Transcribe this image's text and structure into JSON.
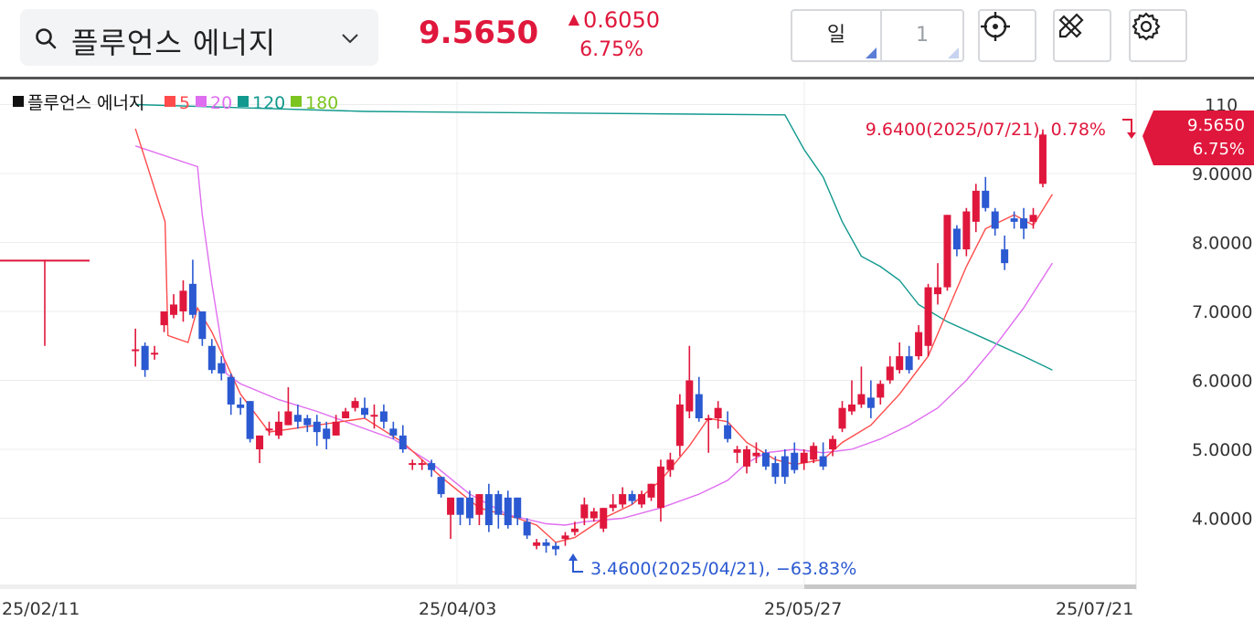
{
  "header": {
    "stock_name": "플루언스 에너지",
    "price": "9.5650",
    "change": "0.6050",
    "change_pct": "6.75%",
    "period_unit": "일",
    "period_count": "1"
  },
  "colors": {
    "up": "#e0173c",
    "down": "#2b59d1",
    "ma5": "#ff4b4b",
    "ma20": "#e06ef0",
    "ma120": "#11998e",
    "ma180": "#7cc520"
  },
  "icons": [
    "search-icon",
    "chevron-down-icon",
    "crosshair-icon",
    "drawing-tools-icon",
    "gear-icon"
  ],
  "chart_data": {
    "type": "candlestick",
    "legend": [
      {
        "label": "플루언스 에너지",
        "color": "#111111"
      },
      {
        "label": "5",
        "color": "#ff4b4b"
      },
      {
        "label": "20",
        "color": "#e06ef0"
      },
      {
        "label": "120",
        "color": "#11998e"
      },
      {
        "label": "180",
        "color": "#7cc520"
      }
    ],
    "x_labels": [
      "25/02/11",
      "25/04/03",
      "25/05/27",
      "25/07/21"
    ],
    "y_ticks": [
      "110",
      "9.0000",
      "8.0000",
      "7.0000",
      "6.0000",
      "5.0000",
      "4.0000"
    ],
    "y_tick_values": [
      10,
      9,
      8,
      7,
      6,
      5,
      4
    ],
    "ylim": [
      2.9,
      10.4
    ],
    "last_price_badge": {
      "price": "9.5650",
      "pct": "6.75%"
    },
    "high_annotation": "9.6400(2025/07/21), 0.78%",
    "low_annotation": "3.4600(2025/04/21), −63.83%",
    "candles": [
      [
        7.75,
        7.75,
        7.75,
        6.5
      ],
      [
        6.45,
        6.45,
        6.75,
        6.2
      ],
      [
        6.5,
        6.15,
        6.55,
        6.05
      ],
      [
        6.4,
        6.4,
        6.5,
        6.3
      ],
      [
        6.8,
        7.0,
        7.0,
        6.7
      ],
      [
        6.95,
        7.1,
        7.25,
        6.9
      ],
      [
        7.0,
        7.3,
        7.45,
        6.85
      ],
      [
        7.4,
        6.95,
        7.75,
        6.9
      ],
      [
        7.0,
        6.6,
        7.0,
        6.5
      ],
      [
        6.5,
        6.15,
        6.6,
        6.1
      ],
      [
        6.25,
        6.1,
        6.35,
        6.0
      ],
      [
        6.05,
        5.65,
        6.1,
        5.5
      ],
      [
        5.65,
        5.6,
        5.75,
        5.5
      ],
      [
        5.7,
        5.15,
        5.7,
        5.1
      ],
      [
        5.0,
        5.2,
        5.2,
        4.8
      ],
      [
        5.3,
        5.3,
        5.4,
        5.2
      ],
      [
        5.2,
        5.4,
        5.55,
        5.15
      ],
      [
        5.35,
        5.55,
        5.9,
        5.35
      ],
      [
        5.5,
        5.4,
        5.65,
        5.3
      ],
      [
        5.45,
        5.35,
        5.5,
        5.25
      ],
      [
        5.4,
        5.25,
        5.5,
        5.05
      ],
      [
        5.3,
        5.15,
        5.4,
        5.0
      ],
      [
        5.2,
        5.4,
        5.5,
        5.2
      ],
      [
        5.45,
        5.55,
        5.6,
        5.45
      ],
      [
        5.6,
        5.7,
        5.75,
        5.55
      ],
      [
        5.6,
        5.5,
        5.75,
        5.45
      ],
      [
        5.5,
        5.5,
        5.65,
        5.3
      ],
      [
        5.55,
        5.4,
        5.65,
        5.3
      ],
      [
        5.3,
        5.2,
        5.4,
        5.15
      ],
      [
        5.2,
        5.0,
        5.35,
        4.95
      ],
      [
        4.8,
        4.8,
        4.85,
        4.7
      ],
      [
        4.8,
        4.8,
        4.85,
        4.7
      ],
      [
        4.8,
        4.7,
        4.85,
        4.6
      ],
      [
        4.6,
        4.35,
        4.6,
        4.3
      ],
      [
        4.05,
        4.3,
        4.3,
        3.7
      ],
      [
        4.3,
        4.05,
        4.3,
        3.9
      ],
      [
        4.3,
        4.0,
        4.4,
        3.9
      ],
      [
        4.05,
        4.35,
        4.35,
        3.9
      ],
      [
        4.35,
        3.9,
        4.5,
        3.8
      ],
      [
        4.35,
        4.05,
        4.4,
        3.85
      ],
      [
        4.3,
        3.9,
        4.4,
        3.85
      ],
      [
        4.3,
        4.0,
        4.3,
        3.9
      ],
      [
        3.95,
        3.75,
        4.0,
        3.7
      ],
      [
        3.6,
        3.65,
        3.7,
        3.55
      ],
      [
        3.65,
        3.6,
        3.7,
        3.5
      ],
      [
        3.6,
        3.55,
        3.65,
        3.46
      ],
      [
        3.7,
        3.75,
        3.8,
        3.6
      ],
      [
        3.8,
        3.85,
        3.95,
        3.75
      ],
      [
        4.0,
        4.2,
        4.3,
        3.9
      ],
      [
        4.0,
        4.1,
        4.15,
        3.95
      ],
      [
        3.85,
        4.15,
        4.15,
        3.8
      ],
      [
        4.15,
        4.2,
        4.35,
        4.1
      ],
      [
        4.2,
        4.35,
        4.45,
        4.15
      ],
      [
        4.35,
        4.25,
        4.4,
        4.2
      ],
      [
        4.2,
        4.35,
        4.4,
        4.15
      ],
      [
        4.3,
        4.5,
        4.5,
        4.25
      ],
      [
        4.15,
        4.75,
        4.85,
        3.95
      ],
      [
        4.7,
        4.85,
        4.95,
        4.6
      ],
      [
        5.05,
        5.65,
        5.8,
        4.9
      ],
      [
        5.55,
        6.0,
        6.5,
        5.45
      ],
      [
        5.8,
        5.45,
        6.05,
        5.4
      ],
      [
        5.45,
        5.45,
        5.5,
        4.95
      ],
      [
        5.45,
        5.6,
        5.7,
        5.3
      ],
      [
        5.35,
        5.15,
        5.55,
        5.1
      ],
      [
        4.95,
        5.0,
        5.05,
        4.8
      ],
      [
        4.75,
        5.0,
        5.05,
        4.65
      ],
      [
        4.9,
        4.95,
        5.1,
        4.8
      ],
      [
        4.95,
        4.75,
        5.0,
        4.7
      ],
      [
        4.8,
        4.6,
        4.9,
        4.5
      ],
      [
        4.9,
        4.6,
        5.0,
        4.5
      ],
      [
        4.95,
        4.7,
        5.1,
        4.65
      ],
      [
        4.8,
        4.95,
        5.0,
        4.7
      ],
      [
        4.85,
        5.05,
        5.1,
        4.8
      ],
      [
        4.9,
        4.75,
        5.1,
        4.7
      ],
      [
        5.0,
        5.15,
        5.2,
        4.9
      ],
      [
        5.3,
        5.6,
        5.7,
        5.25
      ],
      [
        5.55,
        5.65,
        6.0,
        5.5
      ],
      [
        5.65,
        5.8,
        6.2,
        5.6
      ],
      [
        5.75,
        5.6,
        6.0,
        5.45
      ],
      [
        5.75,
        5.95,
        6.0,
        5.65
      ],
      [
        6.0,
        6.2,
        6.35,
        5.95
      ],
      [
        6.15,
        6.35,
        6.55,
        6.1
      ],
      [
        6.35,
        6.15,
        6.5,
        6.1
      ],
      [
        6.35,
        6.7,
        6.8,
        6.3
      ],
      [
        6.5,
        7.35,
        7.4,
        6.35
      ],
      [
        7.25,
        7.35,
        7.7,
        7.1
      ],
      [
        7.35,
        8.4,
        8.4,
        7.3
      ],
      [
        8.2,
        7.9,
        8.25,
        7.8
      ],
      [
        7.9,
        8.45,
        8.5,
        7.8
      ],
      [
        8.3,
        8.75,
        8.85,
        8.15
      ],
      [
        8.75,
        8.5,
        8.95,
        8.45
      ],
      [
        8.45,
        8.2,
        8.5,
        8.1
      ],
      [
        7.9,
        7.7,
        8.1,
        7.6
      ],
      [
        8.35,
        8.3,
        8.45,
        8.2
      ],
      [
        8.35,
        8.2,
        8.5,
        8.05
      ],
      [
        8.3,
        8.4,
        8.5,
        8.2
      ],
      [
        8.85,
        9.565,
        9.64,
        8.8
      ]
    ],
    "ma5": [
      [
        1,
        9.65
      ],
      [
        4.1,
        8.3
      ],
      [
        4.4,
        6.65
      ],
      [
        6.5,
        6.55
      ],
      [
        7.5,
        7.05
      ],
      [
        9,
        6.7
      ],
      [
        12,
        5.8
      ],
      [
        15,
        5.25
      ],
      [
        20,
        5.35
      ],
      [
        25,
        5.45
      ],
      [
        29,
        5.1
      ],
      [
        33,
        4.6
      ],
      [
        37,
        4.15
      ],
      [
        41,
        4.0
      ],
      [
        43,
        3.9
      ],
      [
        45,
        3.65
      ],
      [
        47,
        3.72
      ],
      [
        50,
        4.0
      ],
      [
        53,
        4.2
      ],
      [
        56,
        4.55
      ],
      [
        59,
        5.05
      ],
      [
        61,
        5.45
      ],
      [
        63,
        5.4
      ],
      [
        65,
        5.1
      ],
      [
        68,
        4.85
      ],
      [
        70,
        4.78
      ],
      [
        73,
        4.85
      ],
      [
        75,
        5.1
      ],
      [
        78,
        5.35
      ],
      [
        81,
        5.8
      ],
      [
        84,
        6.35
      ],
      [
        86,
        7.0
      ],
      [
        88,
        7.65
      ],
      [
        90,
        8.2
      ],
      [
        93,
        8.4
      ],
      [
        95,
        8.25
      ],
      [
        97,
        8.7
      ]
    ],
    "ma20": [
      [
        1,
        9.4
      ],
      [
        7.5,
        9.1
      ],
      [
        8,
        8.4
      ],
      [
        9,
        7.4
      ],
      [
        10.5,
        6.1
      ],
      [
        12,
        5.95
      ],
      [
        16,
        5.72
      ],
      [
        20,
        5.55
      ],
      [
        24,
        5.35
      ],
      [
        28,
        5.15
      ],
      [
        32,
        4.8
      ],
      [
        36,
        4.35
      ],
      [
        40,
        4.05
      ],
      [
        44,
        3.92
      ],
      [
        46,
        3.9
      ],
      [
        48,
        3.95
      ],
      [
        52,
        4.0
      ],
      [
        56,
        4.15
      ],
      [
        60,
        4.35
      ],
      [
        63,
        4.55
      ],
      [
        65,
        4.8
      ],
      [
        67,
        4.95
      ],
      [
        70,
        5.0
      ],
      [
        73,
        4.95
      ],
      [
        76,
        5.0
      ],
      [
        79,
        5.15
      ],
      [
        82,
        5.35
      ],
      [
        85,
        5.6
      ],
      [
        88,
        6.0
      ],
      [
        91,
        6.5
      ],
      [
        94,
        7.05
      ],
      [
        97,
        7.7
      ]
    ],
    "ma120": [
      [
        1,
        10.0
      ],
      [
        25,
        9.9
      ],
      [
        69,
        9.85
      ],
      [
        71,
        9.35
      ],
      [
        73,
        8.95
      ],
      [
        75,
        8.3
      ],
      [
        77,
        7.8
      ],
      [
        79,
        7.65
      ],
      [
        81,
        7.45
      ],
      [
        83,
        7.1
      ],
      [
        86,
        6.85
      ],
      [
        90,
        6.6
      ],
      [
        94,
        6.35
      ],
      [
        97,
        6.15
      ]
    ],
    "ma180": []
  }
}
